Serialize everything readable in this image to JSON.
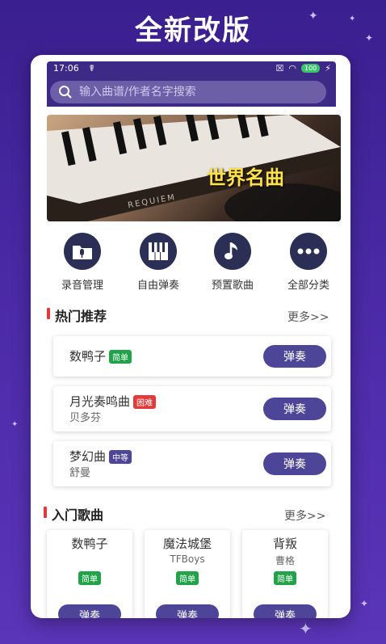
{
  "headline": "全新改版",
  "status": {
    "time": "17:06",
    "battery": "100"
  },
  "search": {
    "placeholder": "输入曲谱/作者名字搜索"
  },
  "banner": {
    "title": "世界名曲",
    "caption": "REQUIEM"
  },
  "categories": [
    {
      "label": "录音管理",
      "icon": "folder-mic-icon"
    },
    {
      "label": "自由弹奏",
      "icon": "piano-keys-icon"
    },
    {
      "label": "预置歌曲",
      "icon": "music-note-icon"
    },
    {
      "label": "全部分类",
      "icon": "more-dots-icon"
    }
  ],
  "hot": {
    "title": "热门推荐",
    "more": "更多>>",
    "items": [
      {
        "name": "数鸭子",
        "tag": "简单",
        "tag_color": "#22a34a",
        "artist": "",
        "play": "弹奏"
      },
      {
        "name": "月光奏鸣曲",
        "tag": "困难",
        "tag_color": "#e23b3b",
        "artist": "贝多芬",
        "play": "弹奏"
      },
      {
        "name": "梦幻曲",
        "tag": "中等",
        "tag_color": "#4d4597",
        "artist": "舒曼",
        "play": "弹奏"
      }
    ]
  },
  "beginner": {
    "title": "入门歌曲",
    "more": "更多>>",
    "items": [
      {
        "name": "数鸭子",
        "artist": "",
        "tag": "简单",
        "play": "弹奏"
      },
      {
        "name": "魔法城堡",
        "artist": "TFBoys",
        "tag": "简单",
        "play": "弹奏"
      },
      {
        "name": "背叛",
        "artist": "曹格",
        "tag": "简单",
        "play": "弹奏"
      }
    ]
  },
  "colors": {
    "accent": "#4d4597",
    "easy": "#22a34a",
    "hard": "#e23b3b"
  }
}
